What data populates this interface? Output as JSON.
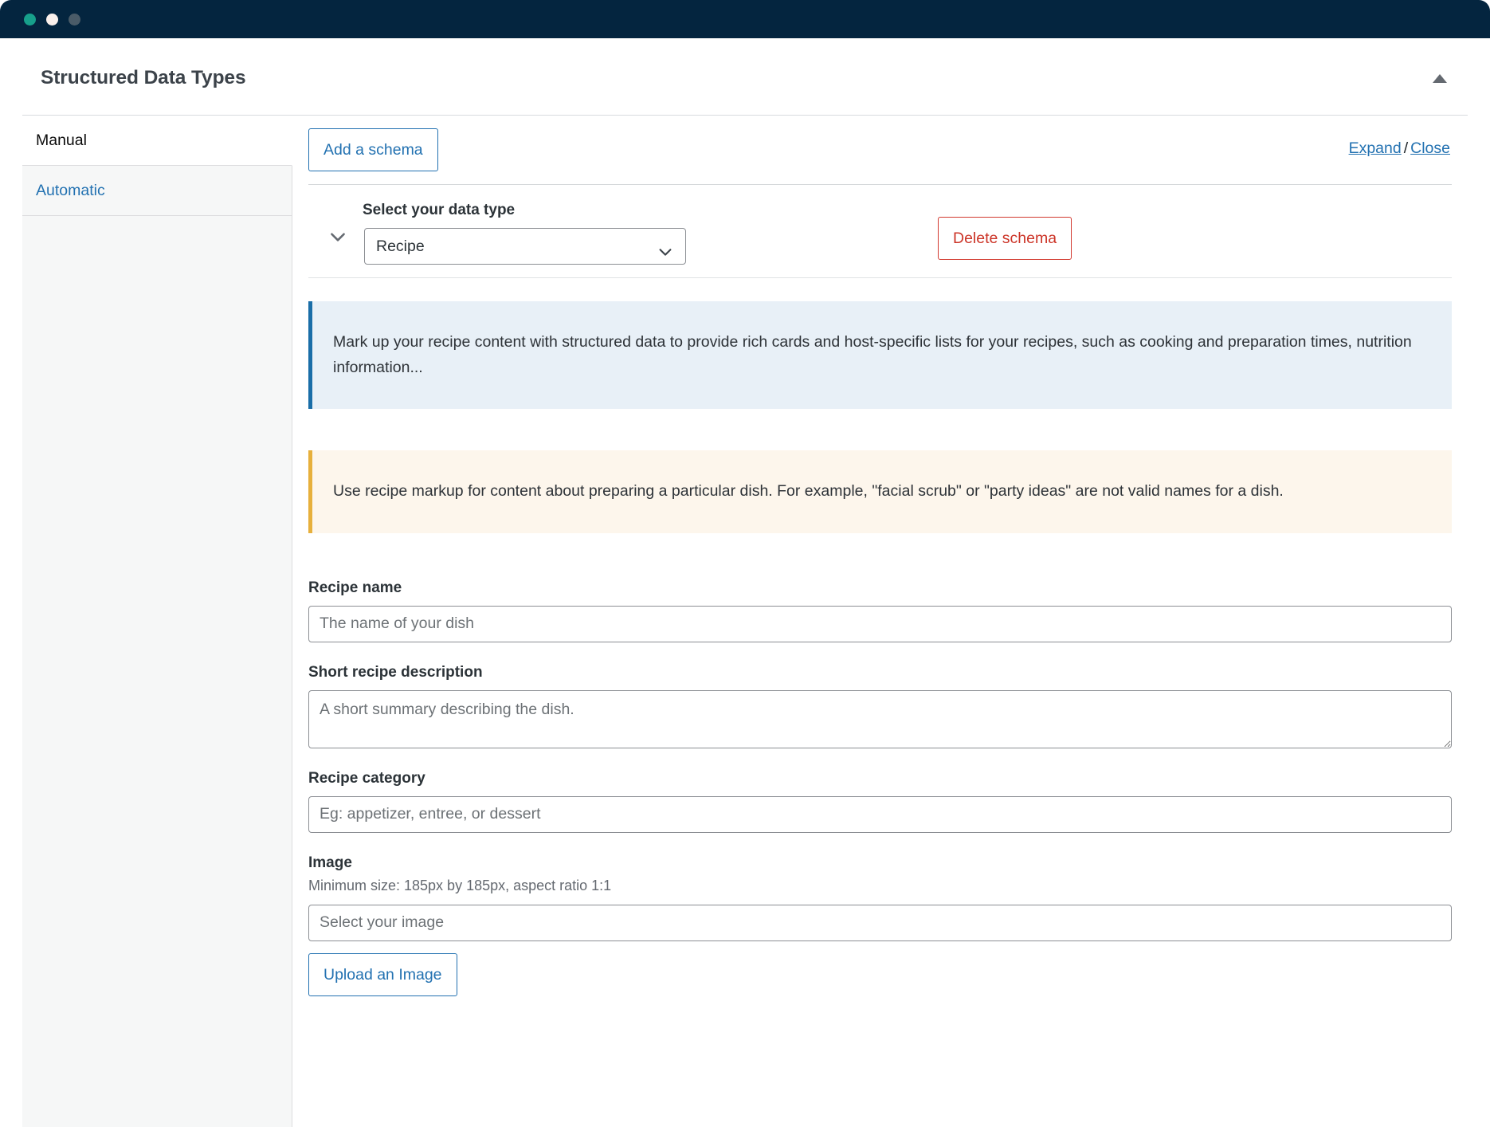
{
  "window": {
    "dots": [
      "close-dot",
      "minimize-dot",
      "maximize-dot"
    ],
    "dot_colors": [
      "#17a08b",
      "#faf0ec",
      "#4a5b68"
    ],
    "chrome_color": "#04253f"
  },
  "metabox": {
    "title": "Structured Data Types",
    "toggle_icon": "caret-up-icon"
  },
  "sidebar": {
    "items": [
      {
        "label": "Manual",
        "active": true
      },
      {
        "label": "Automatic",
        "active": false
      }
    ]
  },
  "toolbar": {
    "add_schema_label": "Add a schema",
    "expand_label": "Expand",
    "separator": "/",
    "close_label": "Close"
  },
  "schema": {
    "collapse_icon": "chevron-down-icon",
    "data_type_label": "Select your data type",
    "data_type_value": "Recipe",
    "data_type_options": [
      "Recipe"
    ],
    "select_icon": "chevron-down-icon",
    "delete_label": "Delete schema",
    "notice_info": "Mark up your recipe content with structured data to provide rich cards and host-specific lists for your recipes, such as cooking and preparation times, nutrition information...",
    "notice_warn": "Use recipe markup for content about preparing a particular dish. For example, \"facial scrub\" or \"party ideas\" are not valid names for a dish."
  },
  "fields": {
    "recipe_name": {
      "label": "Recipe name",
      "placeholder": "The name of your dish",
      "value": ""
    },
    "short_description": {
      "label": "Short recipe description",
      "placeholder": "A short summary describing the dish.",
      "value": ""
    },
    "recipe_category": {
      "label": "Recipe category",
      "placeholder": "Eg: appetizer, entree, or dessert",
      "value": ""
    },
    "image": {
      "label": "Image",
      "help": "Minimum size: 185px by 185px, aspect ratio 1:1",
      "placeholder": "Select your image",
      "value": "",
      "upload_label": "Upload an Image"
    }
  },
  "colors": {
    "link": "#2271b1",
    "danger": "#cc3427",
    "info_bg": "#e8f0f7",
    "info_bar": "#1a6ea8",
    "warn_bg": "#fdf6ec",
    "warn_bar": "#e7b03c",
    "sidebar_bg": "#f6f7f7",
    "heading": "#3c434a"
  }
}
